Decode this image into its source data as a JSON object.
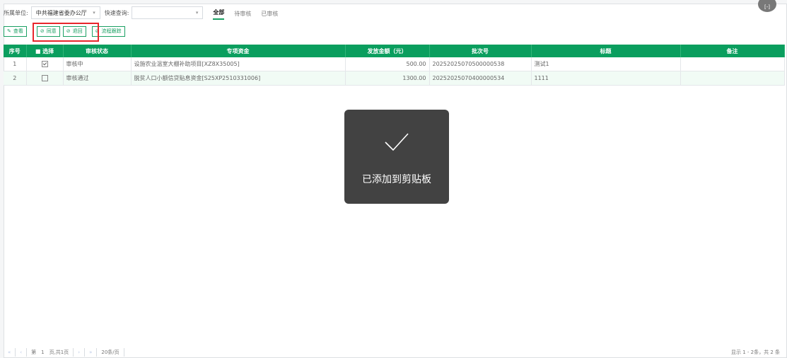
{
  "filter": {
    "unit_label": "所属单位:",
    "unit_value": "中共福建省委办公厅",
    "quick_label": "快速查询:",
    "quick_value": ""
  },
  "tabs": [
    {
      "label": "全部",
      "active": true
    },
    {
      "label": "待审核",
      "active": false
    },
    {
      "label": "已审核",
      "active": false
    }
  ],
  "toolbar": {
    "view_label": "查看",
    "agree_label": "同意",
    "reject_label": "退回",
    "flow_label": "流程跟踪"
  },
  "table": {
    "headers": [
      "序号",
      "■ 选择",
      "审核状态",
      "专项资金",
      "发放金额（元）",
      "批次号",
      "标题",
      "备注"
    ],
    "rows": [
      {
        "no": "1",
        "checked": true,
        "status": "审核中",
        "fund": "设施农业温室大棚补助项目[XZ8X35005]",
        "amount": "500.00",
        "batch": "20252025070500000538",
        "title": "测试1",
        "remark": ""
      },
      {
        "no": "2",
        "checked": false,
        "status": "审核通过",
        "fund": "脱贫人口小额信贷贴息资金[S25XP2510331006]",
        "amount": "1300.00",
        "batch": "20252025070400000534",
        "title": "1111",
        "remark": ""
      }
    ]
  },
  "toast": {
    "message": "已添加到剪贴板"
  },
  "pagination": {
    "first": "«",
    "prev": "‹",
    "page_prefix": "第",
    "page_value": "1",
    "page_suffix": "页,共1页",
    "next": "›",
    "last": "»",
    "page_size": "20条/页",
    "info": "显示 1 - 2条，共 2 条"
  },
  "corner_badge": "[-]",
  "colors": {
    "accent": "#0a9e5e",
    "highlight": "#e8262c"
  },
  "icons": {
    "view": "edit-icon",
    "agree": "check-circle-icon",
    "reject": "check-circle-icon",
    "flow": "check-circle-icon",
    "toast": "checkmark-icon"
  }
}
